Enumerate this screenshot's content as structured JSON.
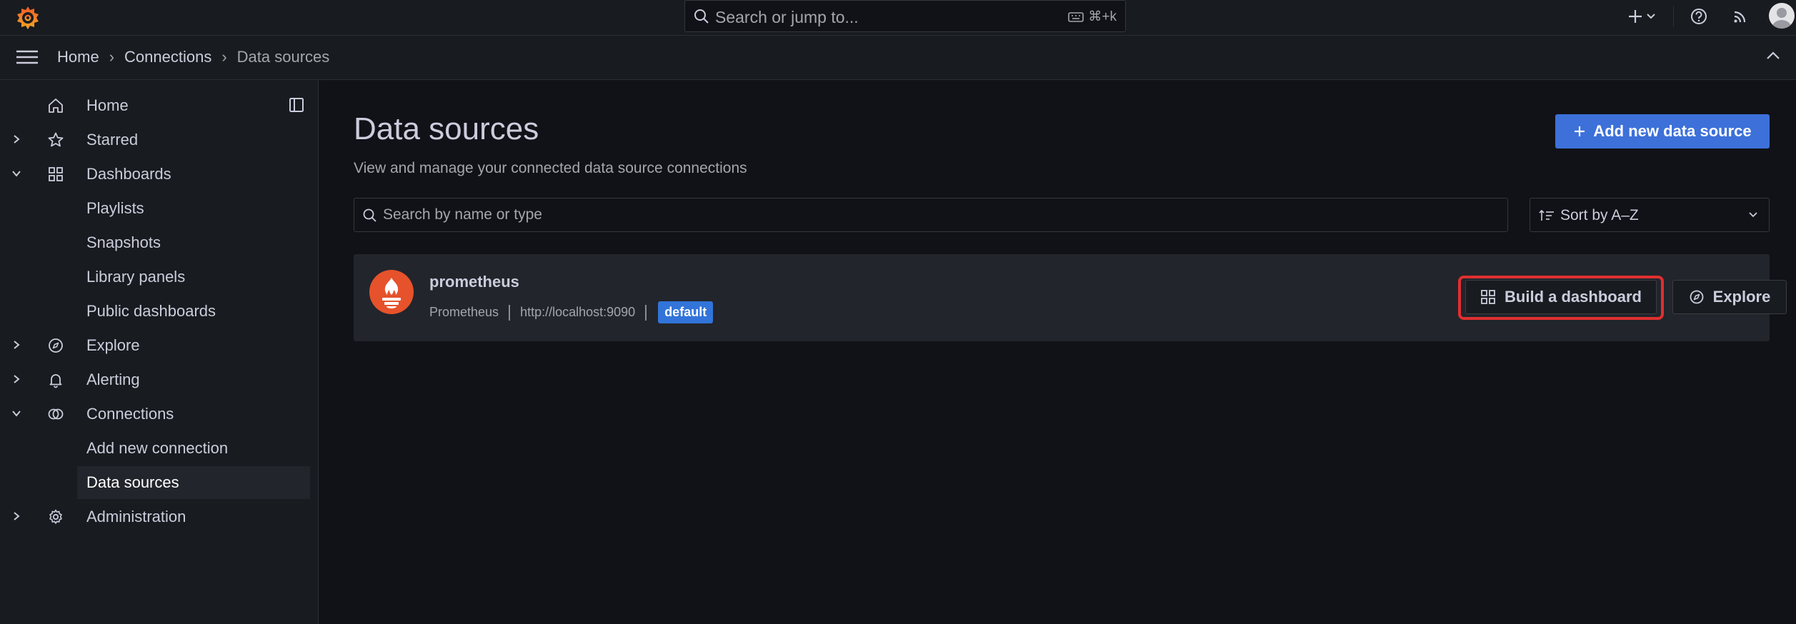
{
  "topbar": {
    "search_placeholder": "Search or jump to...",
    "search_shortcut": "⌘+k"
  },
  "breadcrumb": {
    "items": [
      "Home",
      "Connections",
      "Data sources"
    ]
  },
  "sidebar": {
    "items": [
      {
        "label": "Home"
      },
      {
        "label": "Starred"
      },
      {
        "label": "Dashboards"
      },
      {
        "label": "Playlists"
      },
      {
        "label": "Snapshots"
      },
      {
        "label": "Library panels"
      },
      {
        "label": "Public dashboards"
      },
      {
        "label": "Explore"
      },
      {
        "label": "Alerting"
      },
      {
        "label": "Connections"
      },
      {
        "label": "Add new connection"
      },
      {
        "label": "Data sources"
      },
      {
        "label": "Administration"
      }
    ]
  },
  "page": {
    "title": "Data sources",
    "subtitle": "View and manage your connected data source connections",
    "add_button": "Add new data source",
    "search_placeholder": "Search by name or type",
    "sort_value": "Sort by A–Z"
  },
  "datasource": {
    "name": "prometheus",
    "type": "Prometheus",
    "url": "http://localhost:9090",
    "badge": "default",
    "build_button": "Build a dashboard",
    "explore_button": "Explore"
  },
  "colors": {
    "accent_orange": "#f55f3e",
    "primary_blue": "#3d71d9",
    "highlight_red": "#e02f2f"
  }
}
